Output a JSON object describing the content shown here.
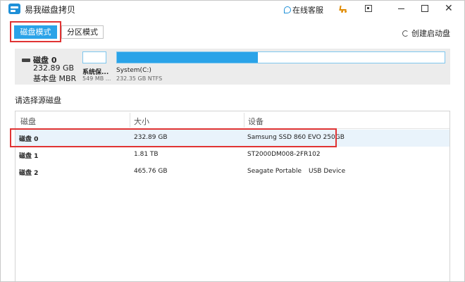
{
  "window": {
    "title": "易我磁盘拷贝"
  },
  "titlebar": {
    "service_label": "在线客服"
  },
  "modes": {
    "disk_mode": "磁盘模式",
    "partition_mode": "分区模式"
  },
  "actions": {
    "create_boot": "创建启动盘"
  },
  "disk_map": {
    "disk_name": "磁盘 0",
    "disk_size": "232.89 GB",
    "disk_type": "基本盘 MBR",
    "partitions": [
      {
        "name": "系统保...",
        "info": "549 MB ...",
        "used_fraction": 0
      },
      {
        "name": "System(C:)",
        "info": "232.35 GB NTFS",
        "used_fraction": 0.43
      }
    ]
  },
  "source_label": "请选择源磁盘",
  "table": {
    "columns": [
      "磁盘",
      "大小",
      "设备"
    ],
    "rows": [
      {
        "name": "磁盘 0",
        "size": "232.89 GB",
        "device": "Samsung SSD 860 EVO 250GB",
        "device_type": "",
        "selected": true
      },
      {
        "name": "磁盘 1",
        "size": "1.81 TB",
        "device": "ST2000DM008-2FR102",
        "device_type": "",
        "selected": false
      },
      {
        "name": "磁盘 2",
        "size": "465.76 GB",
        "device": "Seagate  Portable",
        "device_type": "USB Device",
        "selected": false
      }
    ]
  }
}
